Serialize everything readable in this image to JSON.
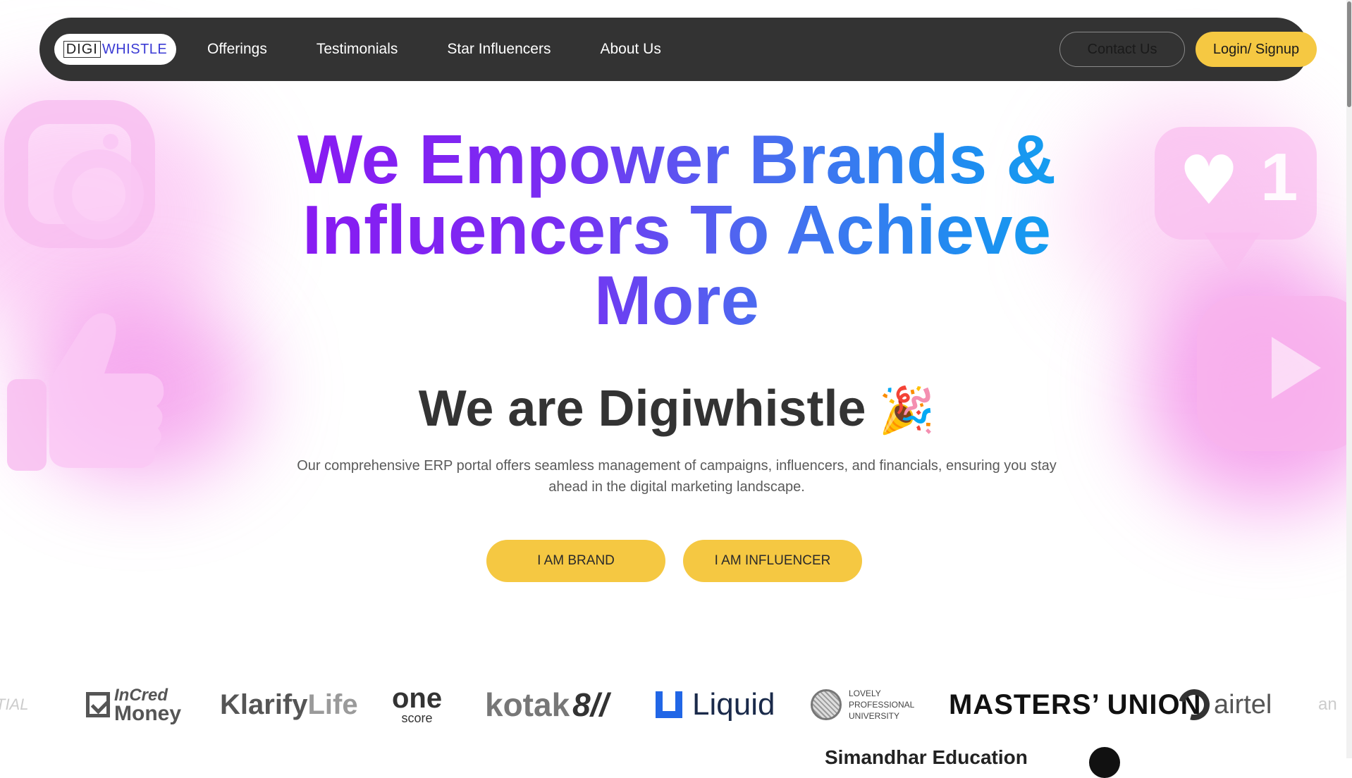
{
  "nav": {
    "logo_part1": "DIGI",
    "logo_part2": "WHISTLE",
    "links": [
      "Offerings",
      "Testimonials",
      "Star Influencers",
      "About Us"
    ],
    "contact_label": "Contact Us",
    "login_label": "Login/ Signup"
  },
  "hero": {
    "title": "We Empower Brands & Influencers To Achieve More",
    "subtitle": "We are Digiwhistle",
    "subtitle_emoji": "🎉",
    "description": "Our comprehensive ERP portal offers seamless management of campaigns, influencers, and financials, ensuring you stay ahead in the digital marketing landscape.",
    "cta_brand": "I AM BRAND",
    "cta_influencer": "I AM INFLUENCER"
  },
  "brands": {
    "partial_left": "TIAL",
    "incred_line1": "InCred",
    "incred_line2": "Money",
    "klarify_1": "Klarify",
    "klarify_2": "Life",
    "onescore_1": "one",
    "onescore_2": "score",
    "kotak": "kotak",
    "kotak_mark": "8//",
    "liquid": "Liquid",
    "lpu_1": "LOVELY",
    "lpu_2": "PROFESSIONAL",
    "lpu_3": "UNIVERSITY",
    "masters": "MASTERS’ UNION",
    "airtel": "airtel",
    "partial_right": "an",
    "row2_b": "Simandhar Education"
  },
  "colors": {
    "nav_bg": "#333333",
    "accent_yellow": "#f5c842",
    "gradient_start": "#8b17f2",
    "gradient_end": "#0fa6f0"
  }
}
